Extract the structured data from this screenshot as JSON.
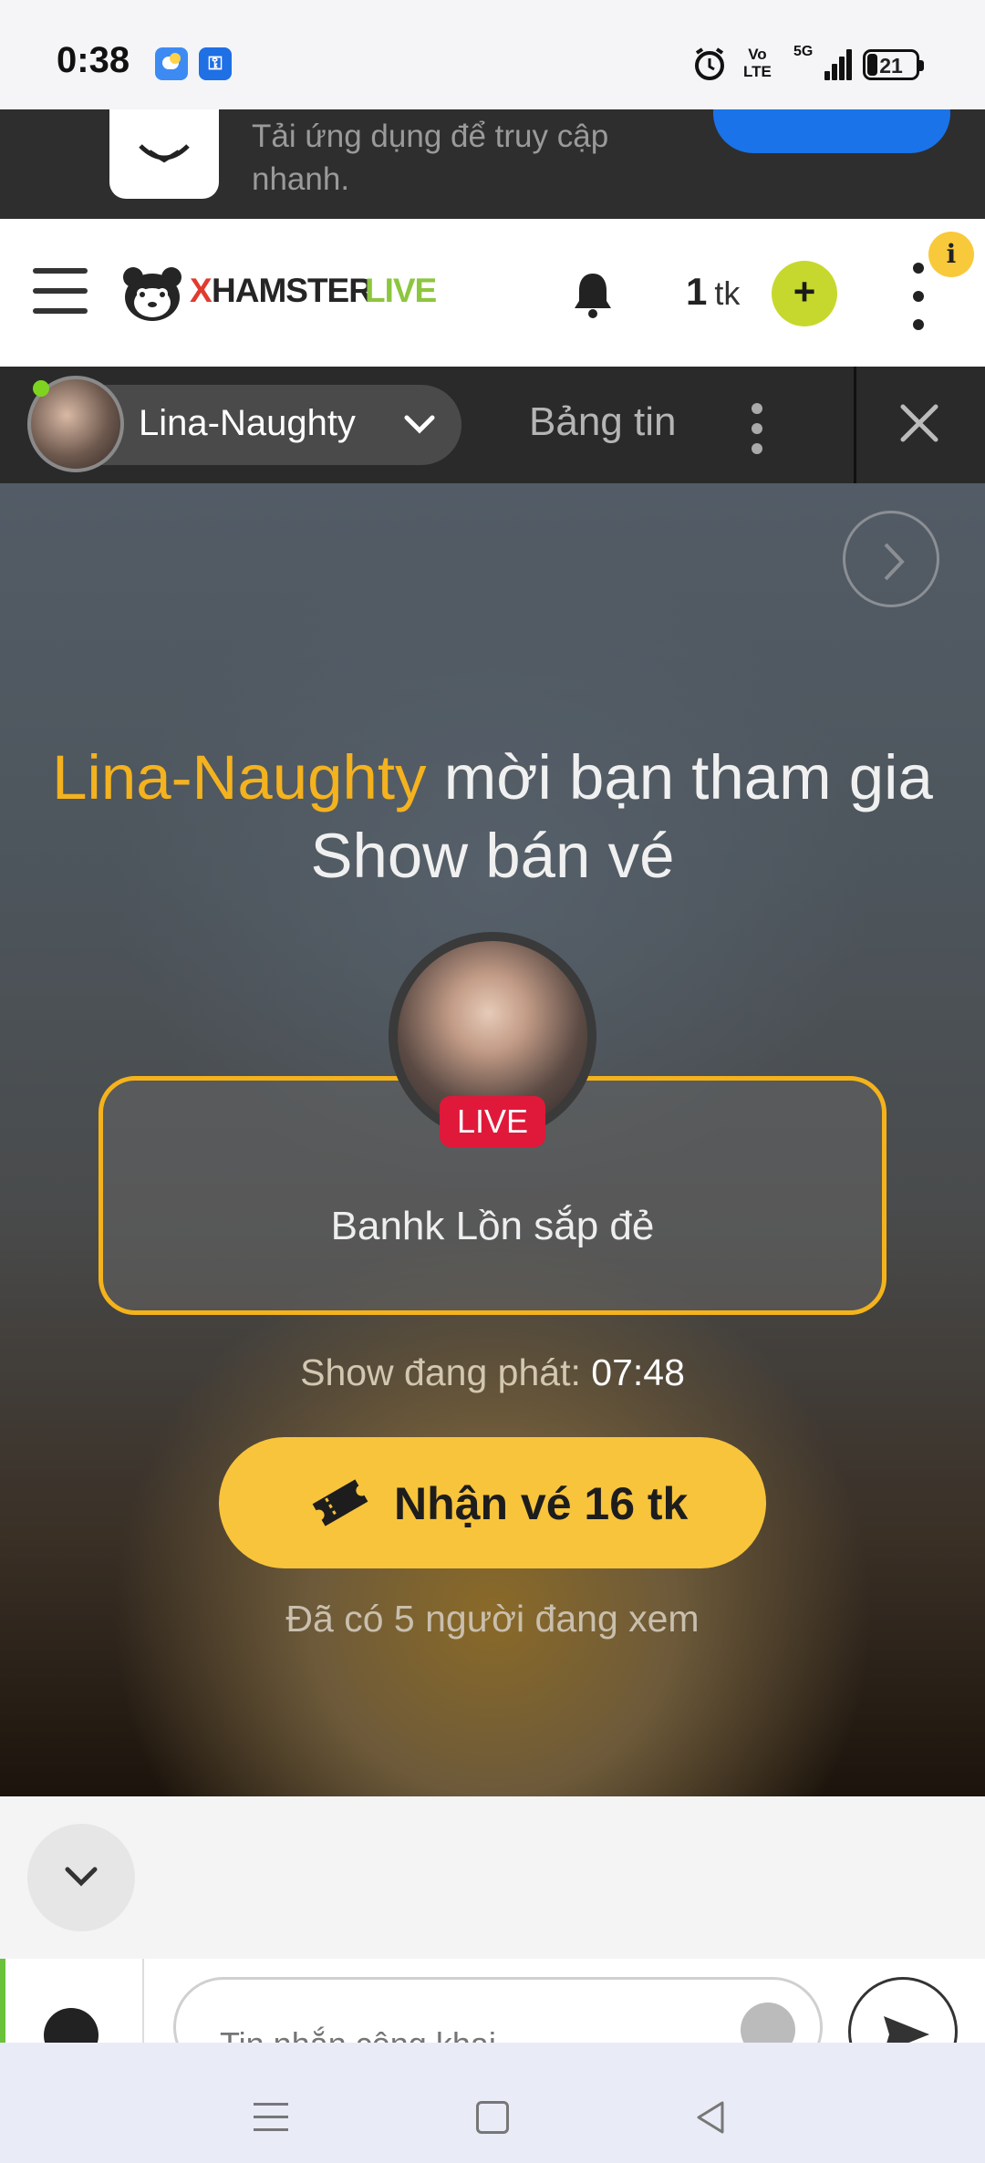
{
  "status_bar": {
    "time": "0:38",
    "volte_line1": "Vo",
    "volte_line2": "LTE",
    "network": "5G",
    "battery": "21",
    "vpn_icon": "key-icon",
    "weather_icon": "weather-icon"
  },
  "install_banner": {
    "text": "Tải ứng dụng để truy cập nhanh."
  },
  "header": {
    "brand_x": "X",
    "brand_hamster": "HAMSTER",
    "brand_live": "LIVE",
    "token_count": "1",
    "token_unit": "tk",
    "add_label": "+",
    "info_label": "i",
    "brand_colors": {
      "x": "#e13b2f",
      "live": "#8cc63e",
      "add": "#c6d82d"
    }
  },
  "room_bar": {
    "model_name": "Lina-Naughty",
    "feed_tab": "Bảng tin"
  },
  "stage": {
    "invite_name": "Lina-Naughty",
    "invite_rest": " mời bạn tham gia Show bán vé",
    "live_badge": "LIVE",
    "show_title": "Banhk Lồn sắp đẻ",
    "timer_label": "Show đang phát:",
    "timer_value": "07:48",
    "buy_label": "Nhận vé 16 tk",
    "viewers": "Đã có 5 người đang xem",
    "accent_color": "#f5b31b",
    "button_color": "#f8c43c",
    "live_color": "#e0193a"
  },
  "chat": {
    "placeholder": "Tin nhắn công khai..."
  }
}
